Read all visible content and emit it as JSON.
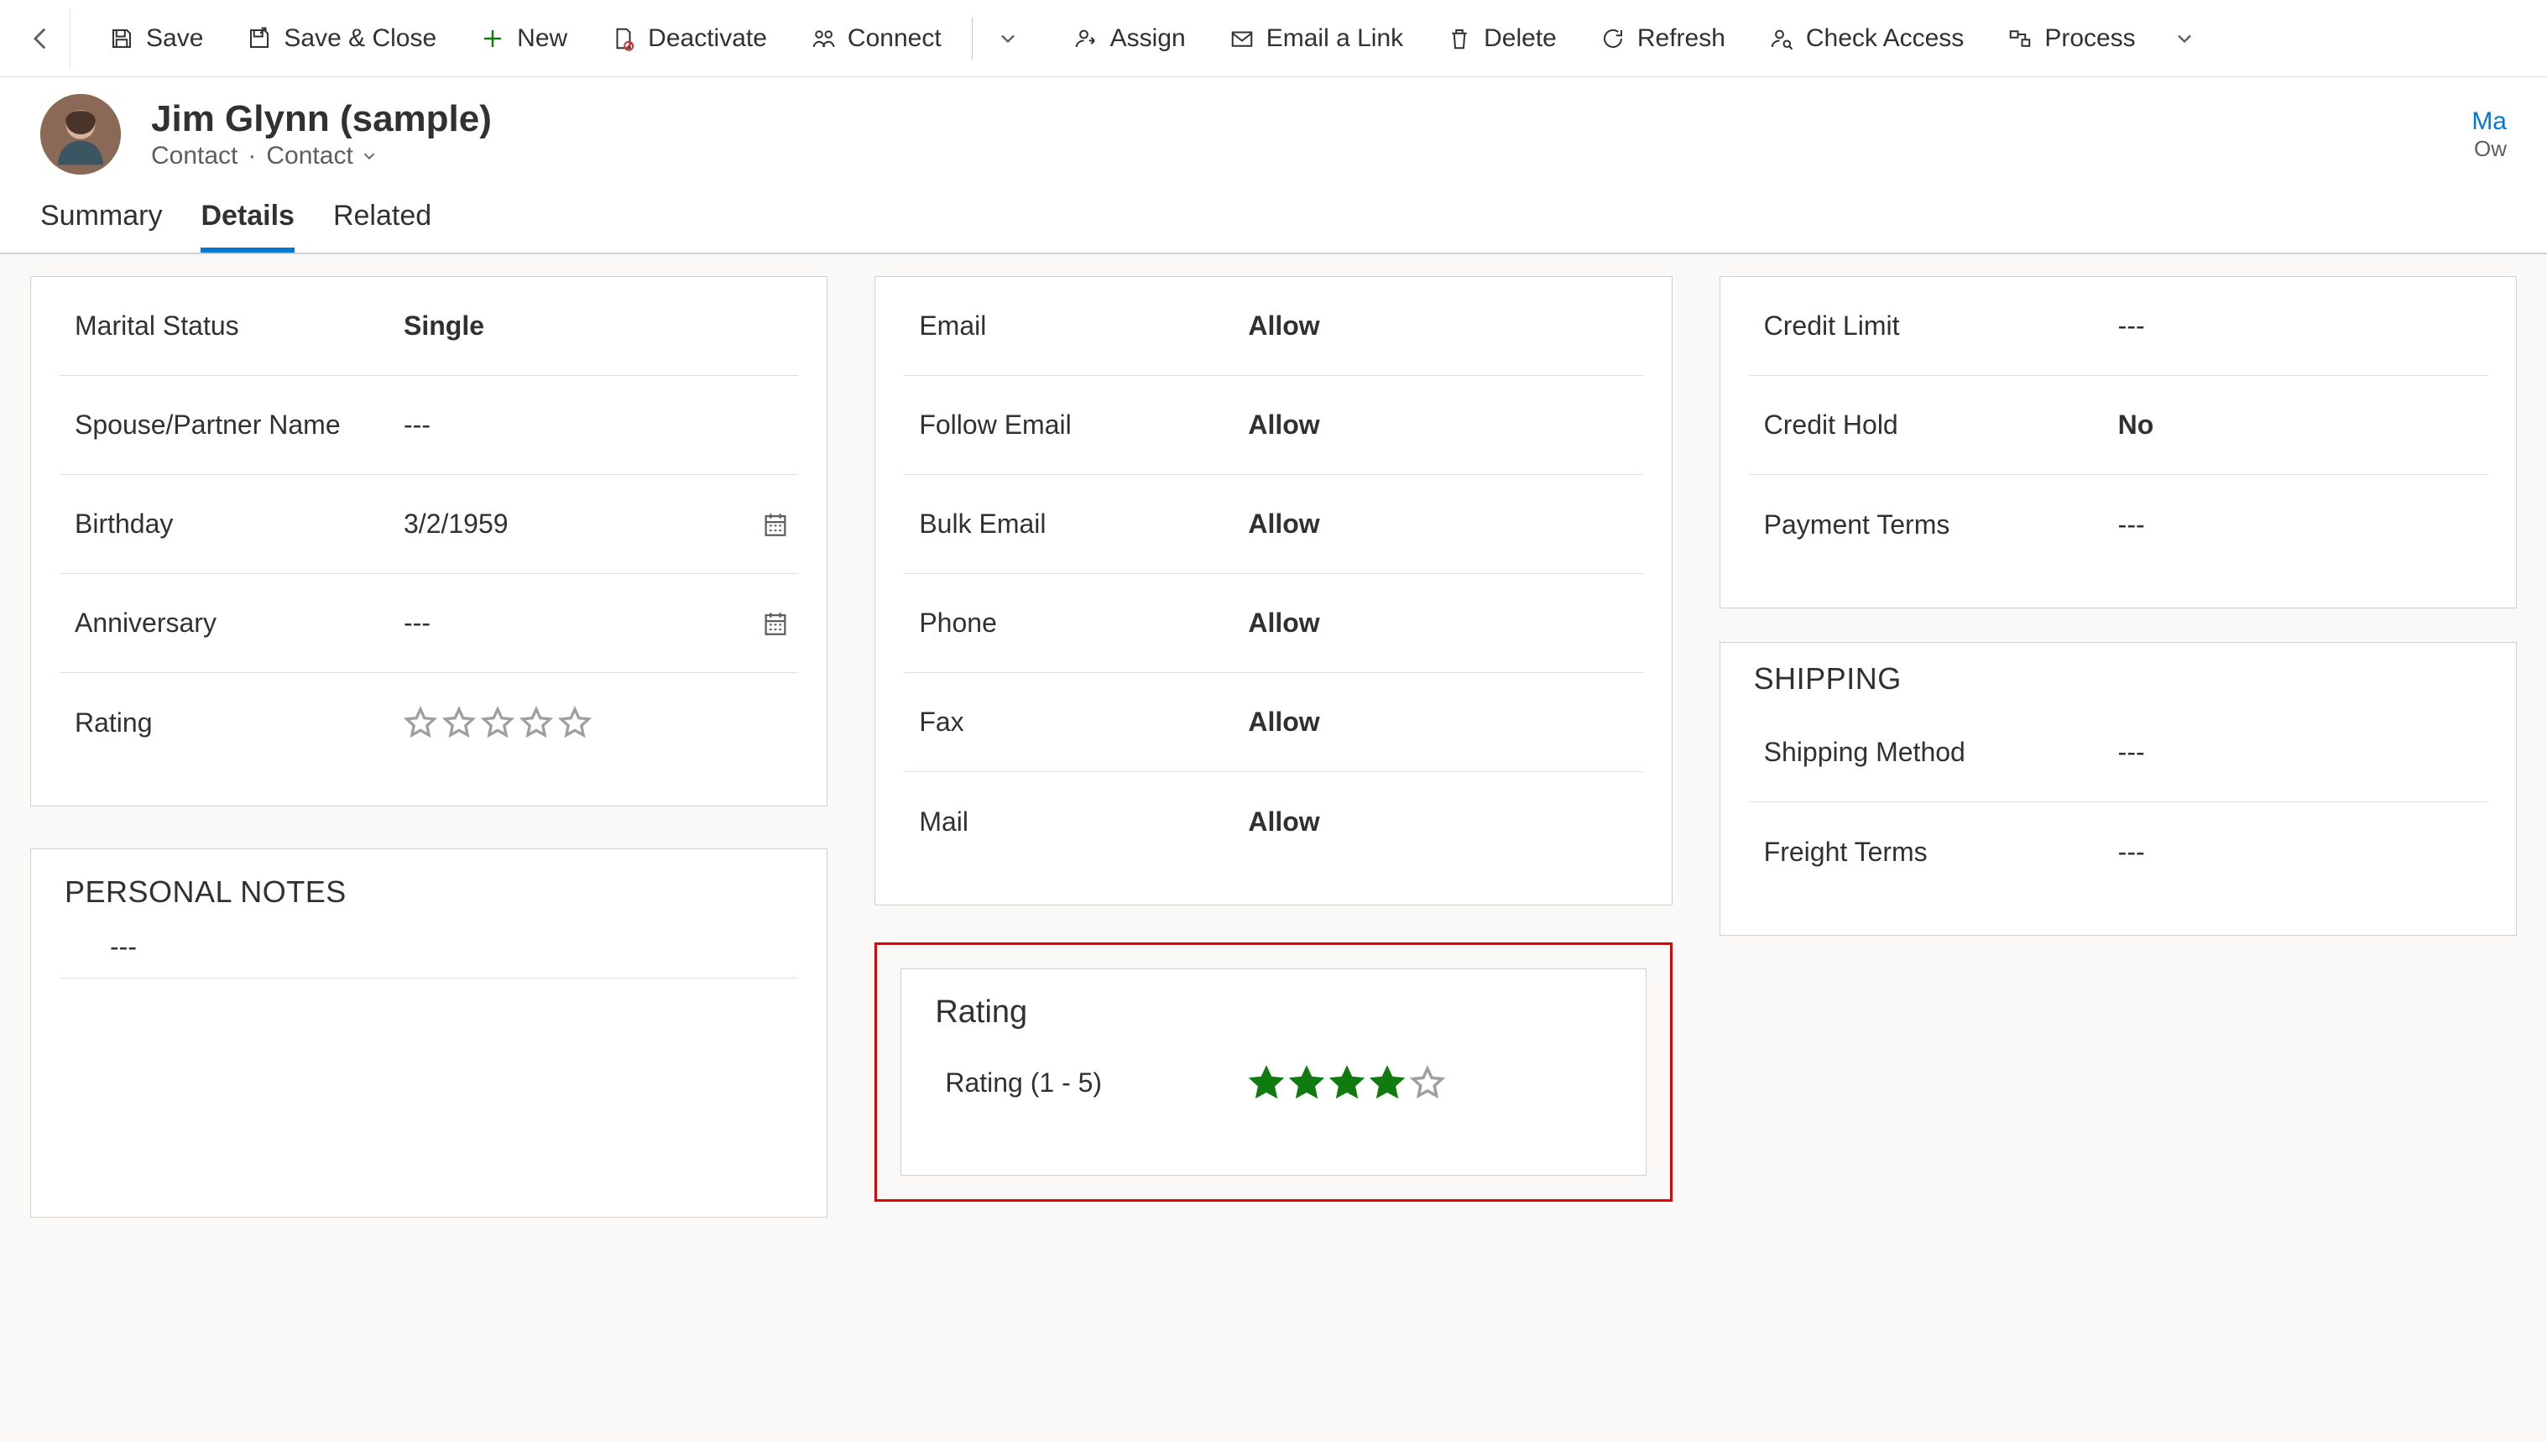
{
  "commands": {
    "save": "Save",
    "saveClose": "Save & Close",
    "new": "New",
    "deactivate": "Deactivate",
    "connect": "Connect",
    "assign": "Assign",
    "emailLink": "Email a Link",
    "delete": "Delete",
    "refresh": "Refresh",
    "checkAccess": "Check Access",
    "process": "Process"
  },
  "record": {
    "name": "Jim Glynn (sample)",
    "entity": "Contact",
    "form": "Contact",
    "ownerLink": "Ma",
    "ownerLabel": "Ow"
  },
  "tabs": {
    "summary": "Summary",
    "details": "Details",
    "related": "Related"
  },
  "personal": {
    "maritalStatusLabel": "Marital Status",
    "maritalStatusValue": "Single",
    "spouseLabel": "Spouse/Partner Name",
    "spouseValue": "---",
    "birthdayLabel": "Birthday",
    "birthdayValue": "3/2/1959",
    "anniversaryLabel": "Anniversary",
    "anniversaryValue": "---",
    "ratingLabel": "Rating"
  },
  "notes": {
    "title": "PERSONAL NOTES",
    "value": "---"
  },
  "contactMethods": {
    "emailLabel": "Email",
    "emailValue": "Allow",
    "followLabel": "Follow Email",
    "followValue": "Allow",
    "bulkLabel": "Bulk Email",
    "bulkValue": "Allow",
    "phoneLabel": "Phone",
    "phoneValue": "Allow",
    "faxLabel": "Fax",
    "faxValue": "Allow",
    "mailLabel": "Mail",
    "mailValue": "Allow"
  },
  "ratingSection": {
    "title": "Rating",
    "fieldLabel": "Rating (1 - 5)",
    "value": 4
  },
  "billing": {
    "creditLimitLabel": "Credit Limit",
    "creditLimitValue": "---",
    "creditHoldLabel": "Credit Hold",
    "creditHoldValue": "No",
    "paymentTermsLabel": "Payment Terms",
    "paymentTermsValue": "---"
  },
  "shipping": {
    "title": "SHIPPING",
    "methodLabel": "Shipping Method",
    "methodValue": "---",
    "freightLabel": "Freight Terms",
    "freightValue": "---"
  }
}
